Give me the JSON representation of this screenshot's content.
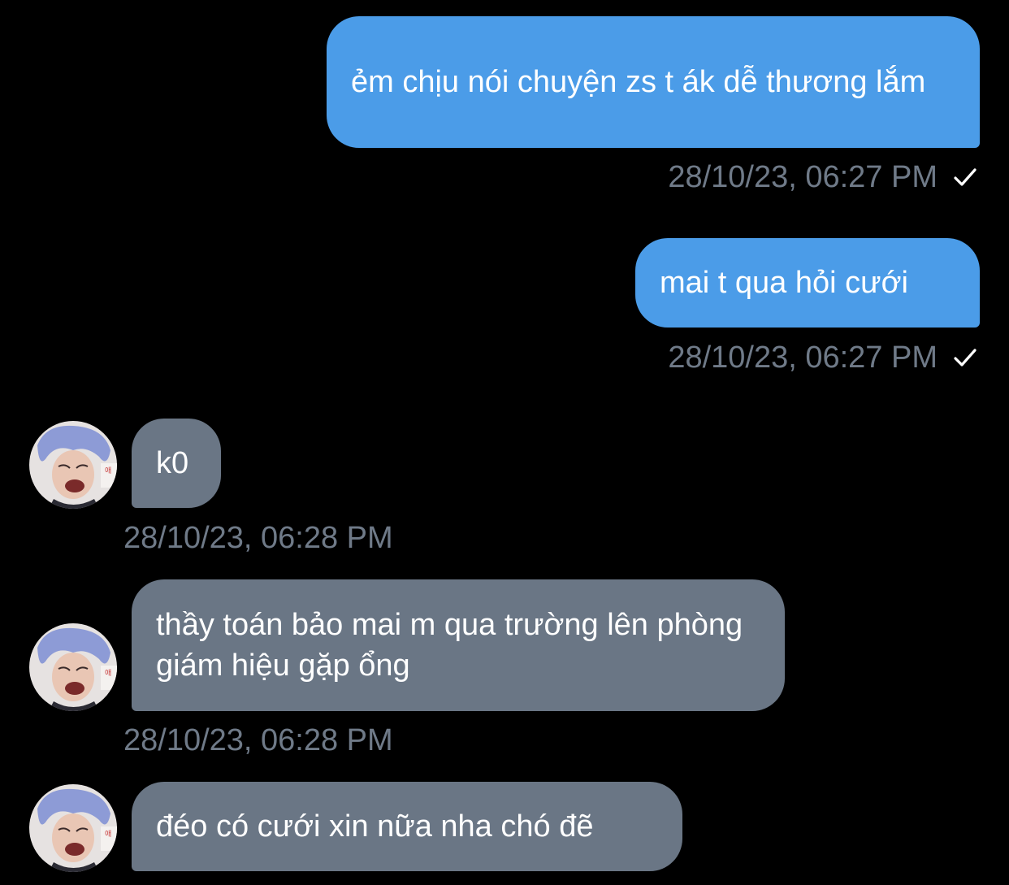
{
  "messages": [
    {
      "direction": "outgoing",
      "text": "ẻm chịu nói chuyện zs t ák dễ thương lắm",
      "timestamp": "28/10/23, 06:27 PM",
      "status_icon": "single-check-icon"
    },
    {
      "direction": "outgoing",
      "text": "mai t qua hỏi cưới",
      "timestamp": "28/10/23, 06:27 PM",
      "status_icon": "single-check-icon"
    },
    {
      "direction": "incoming",
      "text": "k0",
      "timestamp": "28/10/23, 06:28 PM"
    },
    {
      "direction": "incoming",
      "text": "thầy toán bảo mai m qua trường lên phòng giám hiệu gặp ổng",
      "timestamp": "28/10/23, 06:28 PM"
    },
    {
      "direction": "incoming",
      "text": "đéo có cưới xin nữa nha chó đẽ"
    }
  ],
  "colors": {
    "background": "#000000",
    "outgoing_bubble": "#4b9ce8",
    "incoming_bubble": "#6a7685",
    "timestamp": "#6f7a88",
    "text": "#ffffff"
  }
}
